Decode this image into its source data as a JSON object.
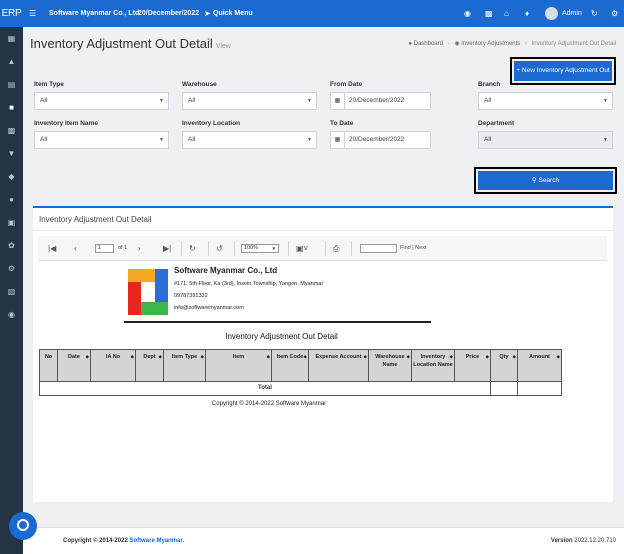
{
  "app": {
    "logo": "ERP"
  },
  "sidebar": {
    "icons": [
      "calculator-icon",
      "chart-icon",
      "card-icon",
      "box-icon",
      "clipboard-icon",
      "cart-icon",
      "diamond-icon",
      "users-icon",
      "building-icon",
      "leaf-icon",
      "gear-icon",
      "book-icon",
      "comment-icon"
    ]
  },
  "topbar": {
    "company": "Software Myanmar Co., Ltd",
    "date": "20/December/2022",
    "quick_menu": "Quick Menu",
    "user": "Admin"
  },
  "page": {
    "title": "Inventory Adjustment Out Detail",
    "title_suffix": "View",
    "new_button": "New Inventory Adjustment Out"
  },
  "breadcrumb": {
    "dashboard": "Dashboard",
    "parent": "Inventory Adjustments",
    "current": "Inventory Adjustment Out Detail"
  },
  "filters": {
    "item_type": {
      "label": "Item Type",
      "value": "All"
    },
    "warehouse": {
      "label": "Warehouse",
      "value": "All"
    },
    "from_date": {
      "label": "From Date",
      "value": "20/December/2022"
    },
    "branch": {
      "label": "Branch",
      "value": "All"
    },
    "inventory_item_name": {
      "label": "Inventory Item Name",
      "value": "All"
    },
    "inventory_location": {
      "label": "Inventory Location",
      "value": "All"
    },
    "to_date": {
      "label": "To Date",
      "value": "20/December/2022"
    },
    "department": {
      "label": "Department",
      "value": "All"
    },
    "search_button": "Search"
  },
  "panel": {
    "title": "Inventory Adjustment Out Detail"
  },
  "viewer": {
    "page_value": "1",
    "page_of": "of 1",
    "zoom": "100%",
    "find_label": "Find | Next"
  },
  "report": {
    "company_name": "Software Myanmar Co., Ltd",
    "address": "#171, 5th Floor, Ka (3rd), Insein Township, Yangon, Myanmar",
    "phone": "09787391332",
    "email": "info@softwaremyanmar.com",
    "title": "Inventory Adjustment Out Detail",
    "columns": [
      "No",
      "Date",
      "IA No",
      "Dept",
      "Item Type",
      "Item",
      "Item Code",
      "Expense Account",
      "Warehouse Name",
      "Inventory Location Name",
      "Price",
      "Qty",
      "Amount"
    ],
    "total_label": "Total",
    "copyright": "Copyright © 2014-2022 Software Myanmar"
  },
  "footer": {
    "copyright": "Copyright © 2014-2022",
    "brand": "Software Myanmar.",
    "version_label": "Version",
    "version": "2022.12.20.710"
  }
}
